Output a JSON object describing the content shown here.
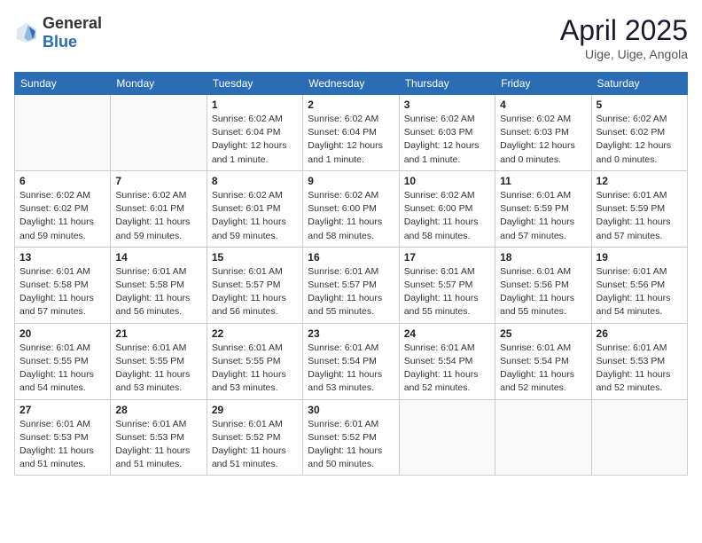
{
  "header": {
    "logo": {
      "general": "General",
      "blue": "Blue"
    },
    "title": "April 2025",
    "location": "Uige, Uige, Angola"
  },
  "calendar": {
    "days_of_week": [
      "Sunday",
      "Monday",
      "Tuesday",
      "Wednesday",
      "Thursday",
      "Friday",
      "Saturday"
    ],
    "weeks": [
      [
        {
          "day": "",
          "info": ""
        },
        {
          "day": "",
          "info": ""
        },
        {
          "day": "1",
          "info": "Sunrise: 6:02 AM\nSunset: 6:04 PM\nDaylight: 12 hours\nand 1 minute."
        },
        {
          "day": "2",
          "info": "Sunrise: 6:02 AM\nSunset: 6:04 PM\nDaylight: 12 hours\nand 1 minute."
        },
        {
          "day": "3",
          "info": "Sunrise: 6:02 AM\nSunset: 6:03 PM\nDaylight: 12 hours\nand 1 minute."
        },
        {
          "day": "4",
          "info": "Sunrise: 6:02 AM\nSunset: 6:03 PM\nDaylight: 12 hours\nand 0 minutes."
        },
        {
          "day": "5",
          "info": "Sunrise: 6:02 AM\nSunset: 6:02 PM\nDaylight: 12 hours\nand 0 minutes."
        }
      ],
      [
        {
          "day": "6",
          "info": "Sunrise: 6:02 AM\nSunset: 6:02 PM\nDaylight: 11 hours\nand 59 minutes."
        },
        {
          "day": "7",
          "info": "Sunrise: 6:02 AM\nSunset: 6:01 PM\nDaylight: 11 hours\nand 59 minutes."
        },
        {
          "day": "8",
          "info": "Sunrise: 6:02 AM\nSunset: 6:01 PM\nDaylight: 11 hours\nand 59 minutes."
        },
        {
          "day": "9",
          "info": "Sunrise: 6:02 AM\nSunset: 6:00 PM\nDaylight: 11 hours\nand 58 minutes."
        },
        {
          "day": "10",
          "info": "Sunrise: 6:02 AM\nSunset: 6:00 PM\nDaylight: 11 hours\nand 58 minutes."
        },
        {
          "day": "11",
          "info": "Sunrise: 6:01 AM\nSunset: 5:59 PM\nDaylight: 11 hours\nand 57 minutes."
        },
        {
          "day": "12",
          "info": "Sunrise: 6:01 AM\nSunset: 5:59 PM\nDaylight: 11 hours\nand 57 minutes."
        }
      ],
      [
        {
          "day": "13",
          "info": "Sunrise: 6:01 AM\nSunset: 5:58 PM\nDaylight: 11 hours\nand 57 minutes."
        },
        {
          "day": "14",
          "info": "Sunrise: 6:01 AM\nSunset: 5:58 PM\nDaylight: 11 hours\nand 56 minutes."
        },
        {
          "day": "15",
          "info": "Sunrise: 6:01 AM\nSunset: 5:57 PM\nDaylight: 11 hours\nand 56 minutes."
        },
        {
          "day": "16",
          "info": "Sunrise: 6:01 AM\nSunset: 5:57 PM\nDaylight: 11 hours\nand 55 minutes."
        },
        {
          "day": "17",
          "info": "Sunrise: 6:01 AM\nSunset: 5:57 PM\nDaylight: 11 hours\nand 55 minutes."
        },
        {
          "day": "18",
          "info": "Sunrise: 6:01 AM\nSunset: 5:56 PM\nDaylight: 11 hours\nand 55 minutes."
        },
        {
          "day": "19",
          "info": "Sunrise: 6:01 AM\nSunset: 5:56 PM\nDaylight: 11 hours\nand 54 minutes."
        }
      ],
      [
        {
          "day": "20",
          "info": "Sunrise: 6:01 AM\nSunset: 5:55 PM\nDaylight: 11 hours\nand 54 minutes."
        },
        {
          "day": "21",
          "info": "Sunrise: 6:01 AM\nSunset: 5:55 PM\nDaylight: 11 hours\nand 53 minutes."
        },
        {
          "day": "22",
          "info": "Sunrise: 6:01 AM\nSunset: 5:55 PM\nDaylight: 11 hours\nand 53 minutes."
        },
        {
          "day": "23",
          "info": "Sunrise: 6:01 AM\nSunset: 5:54 PM\nDaylight: 11 hours\nand 53 minutes."
        },
        {
          "day": "24",
          "info": "Sunrise: 6:01 AM\nSunset: 5:54 PM\nDaylight: 11 hours\nand 52 minutes."
        },
        {
          "day": "25",
          "info": "Sunrise: 6:01 AM\nSunset: 5:54 PM\nDaylight: 11 hours\nand 52 minutes."
        },
        {
          "day": "26",
          "info": "Sunrise: 6:01 AM\nSunset: 5:53 PM\nDaylight: 11 hours\nand 52 minutes."
        }
      ],
      [
        {
          "day": "27",
          "info": "Sunrise: 6:01 AM\nSunset: 5:53 PM\nDaylight: 11 hours\nand 51 minutes."
        },
        {
          "day": "28",
          "info": "Sunrise: 6:01 AM\nSunset: 5:53 PM\nDaylight: 11 hours\nand 51 minutes."
        },
        {
          "day": "29",
          "info": "Sunrise: 6:01 AM\nSunset: 5:52 PM\nDaylight: 11 hours\nand 51 minutes."
        },
        {
          "day": "30",
          "info": "Sunrise: 6:01 AM\nSunset: 5:52 PM\nDaylight: 11 hours\nand 50 minutes."
        },
        {
          "day": "",
          "info": ""
        },
        {
          "day": "",
          "info": ""
        },
        {
          "day": "",
          "info": ""
        }
      ]
    ]
  }
}
